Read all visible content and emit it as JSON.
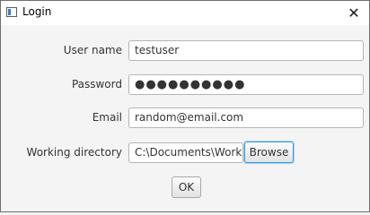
{
  "window": {
    "title": "Login",
    "close_glyph": "✕",
    "app_icon": "window-app-icon"
  },
  "form": {
    "username": {
      "label": "User name",
      "value": "testuser"
    },
    "password": {
      "label": "Password",
      "value": "●●●●●●●●●●"
    },
    "email": {
      "label": "Email",
      "value": "random@email.com"
    },
    "directory": {
      "label": "Working directory",
      "value": "C:\\Documents\\Workir",
      "browse_label": "Browse"
    },
    "ok_label": "OK"
  },
  "colors": {
    "focus_ring": "#3a9ad9",
    "app_icon_accent": "#3b78c9"
  }
}
